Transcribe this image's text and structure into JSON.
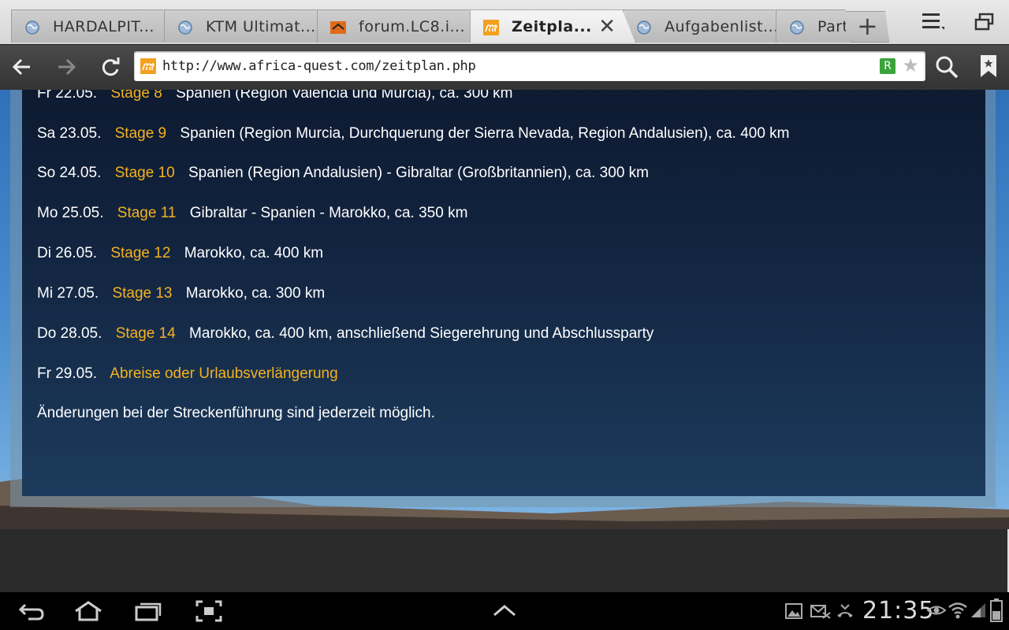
{
  "browser": {
    "tabs": [
      {
        "label": "HARDALPIT...",
        "favicon": "globe-icon"
      },
      {
        "label": "KTM Ultimat...",
        "favicon": "globe-icon"
      },
      {
        "label": "forum.LC8.i...",
        "favicon": "lc8-logo-icon"
      },
      {
        "label": "Zeitpla...",
        "favicon": "camel-icon",
        "active": true
      },
      {
        "label": "Aufgabenlist...",
        "favicon": "globe-icon"
      },
      {
        "label": "Part",
        "favicon": "globe-icon"
      }
    ],
    "url": "http://www.africa-quest.com/zeitplan.php"
  },
  "schedule": [
    {
      "date": "Fr 22.05.",
      "stage": "Stage 8",
      "desc": "Spanien (Region Valencia und Murcia), ca. 300 km"
    },
    {
      "date": "Sa 23.05.",
      "stage": "Stage 9",
      "desc": "Spanien (Region Murcia, Durchquerung der Sierra Nevada, Region Andalusien), ca. 400 km"
    },
    {
      "date": "So 24.05.",
      "stage": "Stage 10",
      "desc": "Spanien (Region Andalusien) - Gibraltar (Großbritannien), ca. 300 km"
    },
    {
      "date": "Mo 25.05.",
      "stage": "Stage 11",
      "desc": "Gibraltar - Spanien - Marokko, ca. 350 km"
    },
    {
      "date": "Di 26.05.",
      "stage": "Stage 12",
      "desc": "Marokko, ca. 400 km"
    },
    {
      "date": "Mi 27.05.",
      "stage": "Stage 13",
      "desc": "Marokko, ca. 300 km"
    },
    {
      "date": "Do 28.05.",
      "stage": "Stage 14",
      "desc": "Marokko, ca. 400 km, anschließend Siegerehrung und Abschlussparty"
    },
    {
      "date": "Fr 29.05.",
      "stage": "Abreise oder Urlaubsverlängerung",
      "desc": ""
    }
  ],
  "note": "Änderungen bei der Streckenführung sind jederzeit möglich.",
  "system": {
    "clock": "21:35"
  },
  "colors": {
    "stage": "#f5b21e",
    "panel": "#122440"
  }
}
